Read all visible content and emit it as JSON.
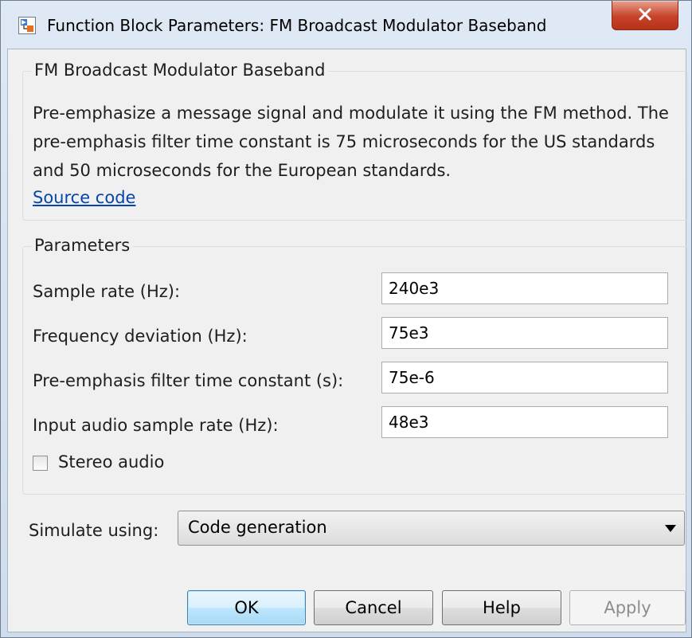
{
  "window": {
    "title": "Function Block Parameters: FM Broadcast Modulator Baseband"
  },
  "description_group": {
    "legend": "FM Broadcast Modulator Baseband",
    "text": "Pre-emphasize a message signal and modulate it using the FM method. The pre-emphasis filter time constant is 75 microseconds for the US standards and 50 microseconds for the European standards.",
    "link_label": "Source code"
  },
  "parameters_group": {
    "legend": "Parameters",
    "fields": [
      {
        "label": "Sample rate (Hz):",
        "value": "240e3"
      },
      {
        "label": "Frequency deviation (Hz):",
        "value": "75e3"
      },
      {
        "label": "Pre-emphasis filter time constant (s):",
        "value": "75e-6"
      },
      {
        "label": "Input audio sample rate (Hz):",
        "value": "48e3"
      }
    ],
    "stereo_label": "Stereo audio",
    "stereo_checked": false
  },
  "simulate": {
    "label": "Simulate using:",
    "selected": "Code generation"
  },
  "buttons": {
    "ok": "OK",
    "cancel": "Cancel",
    "help": "Help",
    "apply": "Apply"
  },
  "colors": {
    "link": "#0645ad",
    "close_button": "#c7432a",
    "ok_border": "#3c7fb1"
  },
  "icons": {
    "app": "simulink-block-icon",
    "close": "close-icon",
    "dropdown": "dropdown-arrow-icon"
  }
}
